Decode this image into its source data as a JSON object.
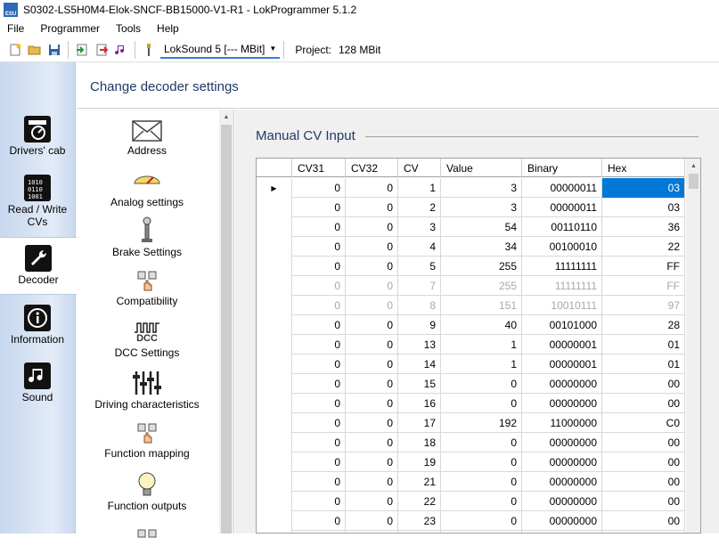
{
  "window": {
    "title": "S0302-LS5H0M4-Elok-SNCF-BB15000-V1-R1 - LokProgrammer 5.1.2",
    "app_icon_text": "ESU"
  },
  "menu": [
    "File",
    "Programmer",
    "Tools",
    "Help"
  ],
  "toolbar": {
    "buttons": [
      "new-icon",
      "open-icon",
      "save-icon",
      "read-icon",
      "write-icon",
      "sound-icon",
      "connect-icon"
    ],
    "decoder_select": "LokSound 5 [--- MBit]",
    "project_label": "Project:",
    "project_value": "128 MBit"
  },
  "sidebar": {
    "items": [
      {
        "label": "Drivers' cab",
        "icon": "gauge-icon"
      },
      {
        "label": "Read / Write CVs",
        "icon": "binary-icon"
      },
      {
        "label": "Decoder",
        "icon": "wrench-icon"
      },
      {
        "label": "Information",
        "icon": "info-icon"
      },
      {
        "label": "Sound",
        "icon": "music-icon"
      }
    ]
  },
  "header": {
    "title": "Change decoder settings"
  },
  "categories": [
    {
      "label": "Address",
      "icon": "envelope-icon"
    },
    {
      "label": "Analog settings",
      "icon": "analog-icon"
    },
    {
      "label": "Brake Settings",
      "icon": "brake-icon"
    },
    {
      "label": "Compatibility",
      "icon": "hand-icon"
    },
    {
      "label": "DCC Settings",
      "icon": "dcc-icon",
      "icon_text": "DCC"
    },
    {
      "label": "Driving characteristics",
      "icon": "sliders-icon"
    },
    {
      "label": "Function mapping",
      "icon": "hand-icon"
    },
    {
      "label": "Function outputs",
      "icon": "bulb-icon"
    }
  ],
  "section": {
    "title": "Manual CV Input"
  },
  "grid": {
    "columns": [
      "CV31",
      "CV32",
      "CV",
      "Value",
      "Binary",
      "Hex"
    ],
    "rows": [
      {
        "cv31": "0",
        "cv32": "0",
        "cv": "1",
        "value": "3",
        "binary": "00000011",
        "hex": "03",
        "current": true,
        "selected": true
      },
      {
        "cv31": "0",
        "cv32": "0",
        "cv": "2",
        "value": "3",
        "binary": "00000011",
        "hex": "03"
      },
      {
        "cv31": "0",
        "cv32": "0",
        "cv": "3",
        "value": "54",
        "binary": "00110110",
        "hex": "36"
      },
      {
        "cv31": "0",
        "cv32": "0",
        "cv": "4",
        "value": "34",
        "binary": "00100010",
        "hex": "22"
      },
      {
        "cv31": "0",
        "cv32": "0",
        "cv": "5",
        "value": "255",
        "binary": "11111111",
        "hex": "FF"
      },
      {
        "cv31": "0",
        "cv32": "0",
        "cv": "7",
        "value": "255",
        "binary": "11111111",
        "hex": "FF",
        "dim": true
      },
      {
        "cv31": "0",
        "cv32": "0",
        "cv": "8",
        "value": "151",
        "binary": "10010111",
        "hex": "97",
        "dim": true
      },
      {
        "cv31": "0",
        "cv32": "0",
        "cv": "9",
        "value": "40",
        "binary": "00101000",
        "hex": "28"
      },
      {
        "cv31": "0",
        "cv32": "0",
        "cv": "13",
        "value": "1",
        "binary": "00000001",
        "hex": "01"
      },
      {
        "cv31": "0",
        "cv32": "0",
        "cv": "14",
        "value": "1",
        "binary": "00000001",
        "hex": "01"
      },
      {
        "cv31": "0",
        "cv32": "0",
        "cv": "15",
        "value": "0",
        "binary": "00000000",
        "hex": "00"
      },
      {
        "cv31": "0",
        "cv32": "0",
        "cv": "16",
        "value": "0",
        "binary": "00000000",
        "hex": "00"
      },
      {
        "cv31": "0",
        "cv32": "0",
        "cv": "17",
        "value": "192",
        "binary": "11000000",
        "hex": "C0"
      },
      {
        "cv31": "0",
        "cv32": "0",
        "cv": "18",
        "value": "0",
        "binary": "00000000",
        "hex": "00"
      },
      {
        "cv31": "0",
        "cv32": "0",
        "cv": "19",
        "value": "0",
        "binary": "00000000",
        "hex": "00"
      },
      {
        "cv31": "0",
        "cv32": "0",
        "cv": "21",
        "value": "0",
        "binary": "00000000",
        "hex": "00"
      },
      {
        "cv31": "0",
        "cv32": "0",
        "cv": "22",
        "value": "0",
        "binary": "00000000",
        "hex": "00"
      },
      {
        "cv31": "0",
        "cv32": "0",
        "cv": "23",
        "value": "0",
        "binary": "00000000",
        "hex": "00"
      },
      {
        "cv31": "",
        "cv32": "",
        "cv": "",
        "value": "",
        "binary": "",
        "hex": ""
      }
    ]
  },
  "colors": {
    "accent": "#0078d7",
    "heading": "#1f3a66",
    "sidebar": "#dbe6f5"
  }
}
